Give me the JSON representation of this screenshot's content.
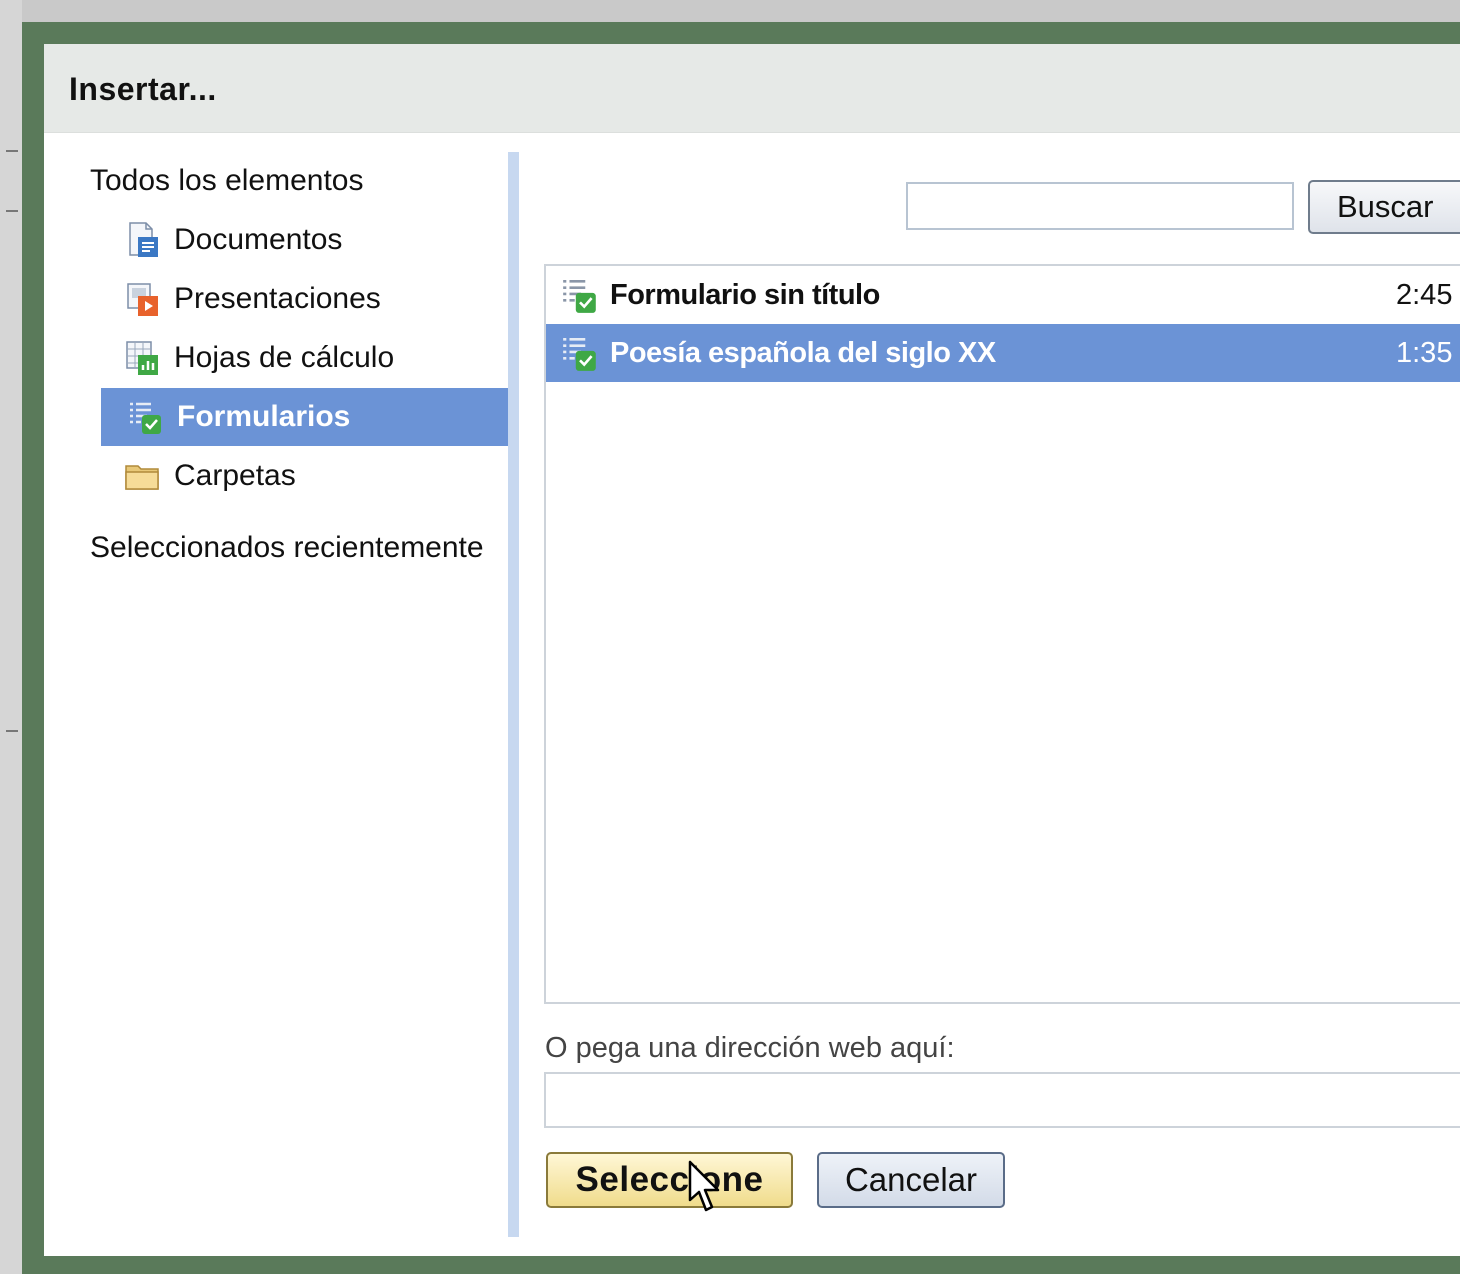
{
  "dialog": {
    "title": "Insertar..."
  },
  "nav": {
    "all_items": "Todos los elementos",
    "items": [
      {
        "label": "Documentos",
        "icon": "document-icon"
      },
      {
        "label": "Presentaciones",
        "icon": "presentation-icon"
      },
      {
        "label": "Hojas de cálculo",
        "icon": "spreadsheet-icon"
      },
      {
        "label": "Formularios",
        "icon": "form-icon",
        "selected": true
      },
      {
        "label": "Carpetas",
        "icon": "folder-icon"
      }
    ],
    "recent": "Seleccionados recientemente"
  },
  "search": {
    "value": "",
    "button_label": "Buscar"
  },
  "files": [
    {
      "name": "Formulario sin título",
      "time": "2:45",
      "icon": "form-icon",
      "selected": false
    },
    {
      "name": "Poesía española del siglo XX",
      "time": "1:35",
      "icon": "form-icon",
      "selected": true
    }
  ],
  "url": {
    "label": "O pega una dirección web aquí:",
    "value": ""
  },
  "actions": {
    "select_label": "Seleccione",
    "cancel_label": "Cancelar"
  },
  "colors": {
    "frame": "#5a7a5a",
    "selection": "#6b93d6",
    "divider": "#c7d8f0"
  }
}
